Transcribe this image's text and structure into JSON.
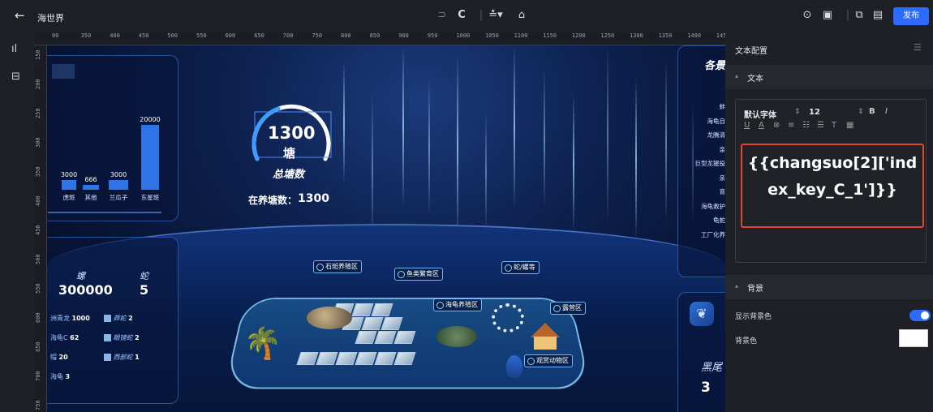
{
  "topbar": {
    "back_icon": "arrow-left-icon",
    "title": "海世界",
    "publish_label": "发布"
  },
  "ruler_top_ticks": [
    "00",
    "350",
    "400",
    "450",
    "500",
    "550",
    "600",
    "650",
    "700",
    "750",
    "800",
    "850",
    "900",
    "950",
    "1000",
    "1050",
    "1100",
    "1150",
    "1200",
    "1250",
    "1300",
    "1350",
    "1400",
    "1450"
  ],
  "ruler_left_ticks": [
    "150",
    "200",
    "250",
    "300",
    "350",
    "400",
    "450",
    "500",
    "550",
    "600",
    "650",
    "700",
    "750"
  ],
  "canvas": {
    "bar_values": [
      "3000",
      "666",
      "3000",
      "20000"
    ],
    "bar_categories": [
      "虎斑",
      "其他",
      "兰瓜子",
      "东星斑"
    ],
    "gauge_value": "1300",
    "gauge_unit": "塘",
    "gauge_label": "总塘数",
    "farming_label": "在养塘数：",
    "farming_value": "1300",
    "stat_left_label": "螺",
    "stat_left_value": "300000",
    "stat_right_label": "蛇",
    "stat_right_value": "5",
    "list_items": [
      {
        "name": "洲青龙",
        "value": "1000"
      },
      {
        "name": "海龟C",
        "value": "62"
      },
      {
        "name": "帽",
        "value": "20"
      },
      {
        "name": "海龟",
        "value": "3"
      }
    ],
    "list_items2": [
      {
        "name": "莽蛇",
        "value": "2"
      },
      {
        "name": "眼镜蛇",
        "value": "2"
      },
      {
        "name": "西部蛇",
        "value": "1"
      }
    ],
    "right_panel_title": "各景",
    "right_panel_items": [
      "蚌",
      "海龟自",
      "龙腾清",
      "亲",
      "巨型龙猩投",
      "亲",
      "育",
      "海龟救护",
      "龟蛇",
      "工厂化养"
    ],
    "right_bottom_label": "黑尾",
    "right_bottom_value": "3",
    "zones": [
      "石斑养殖区",
      "鱼类繁育区",
      "蛇/螺等",
      "海龟养殖区",
      "露营区",
      "观赏动物区"
    ]
  },
  "config": {
    "title": "文本配置",
    "section_text": "文本",
    "font_family": "默认字体",
    "font_size": "12",
    "text_value": "{{changsuo[2]['index_key_C_1']}}",
    "section_bg": "背景",
    "show_bg_label": "显示背景色",
    "bg_color_label": "背景色"
  },
  "colors": {
    "accent": "#2c6bff",
    "highlight": "#e2462e"
  }
}
